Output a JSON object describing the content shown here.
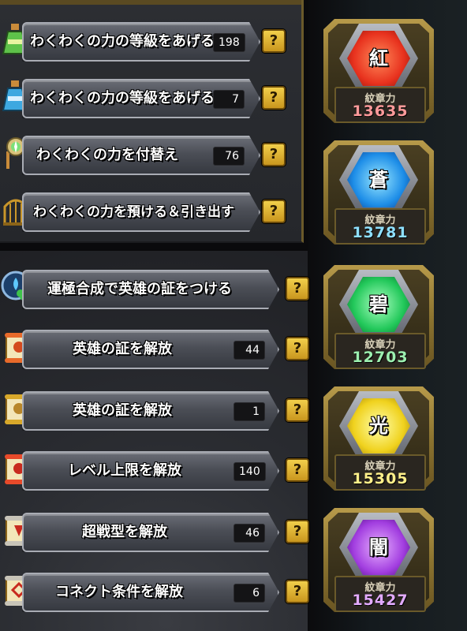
{
  "top_rows": [
    {
      "label": "わくわくの力の等級をあげる",
      "count": "198",
      "icon": "green-potion-icon"
    },
    {
      "label": "わくわくの力の等級をあげる",
      "count": "7",
      "icon": "blue-potion-icon"
    },
    {
      "label": "わくわくの力を付替え",
      "count": "76",
      "icon": "crystal-staff-icon"
    },
    {
      "label": "わくわくの力を預ける＆引き出す",
      "count": "",
      "icon": "birdcage-icon"
    }
  ],
  "bottom_rows": [
    {
      "label": "運極合成で英雄の証をつける",
      "count": "",
      "icon": "clover-orb-icon"
    },
    {
      "label": "英雄の証を解放",
      "count": "44",
      "icon": "scroll-icon"
    },
    {
      "label": "英雄の証を解放",
      "count": "1",
      "icon": "scroll-icon"
    },
    {
      "label": "レベル上限を解放",
      "count": "140",
      "icon": "scroll-icon"
    },
    {
      "label": "超戦型を解放",
      "count": "46",
      "icon": "scroll-icon"
    },
    {
      "label": "コネクト条件を解放",
      "count": "6",
      "icon": "scroll-icon"
    }
  ],
  "help_label": "?",
  "badges": [
    {
      "glyph": "紅",
      "label": "紋章力",
      "value": "13635",
      "color": "#e8321e",
      "value_color": "#ff9a9a"
    },
    {
      "glyph": "蒼",
      "label": "紋章力",
      "value": "13781",
      "color": "#1e8ee8",
      "value_color": "#8ee0ff"
    },
    {
      "glyph": "碧",
      "label": "紋章力",
      "value": "12703",
      "color": "#22c85a",
      "value_color": "#9cf0b0"
    },
    {
      "glyph": "光",
      "label": "紋章力",
      "value": "15305",
      "color": "#f0d21e",
      "value_color": "#fff08a"
    },
    {
      "glyph": "闇",
      "label": "紋章力",
      "value": "15427",
      "color": "#a23ee0",
      "value_color": "#e2aaff"
    }
  ]
}
